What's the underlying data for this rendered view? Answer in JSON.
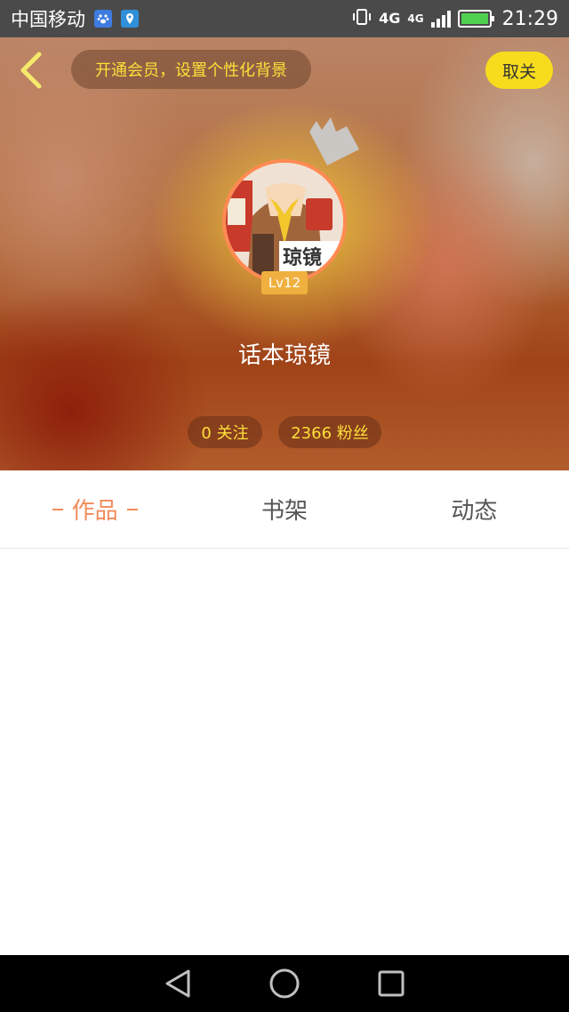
{
  "status_bar": {
    "carrier": "中国移动",
    "network_1": "4G",
    "network_2": "4G",
    "time": "21:29",
    "icons": [
      "baidu-paw-icon",
      "map-pin-icon",
      "vibrate-icon",
      "signal-icon",
      "battery-icon"
    ],
    "battery_color": "#4fd14f"
  },
  "header": {
    "vip_prompt": "开通会员，设置个性化背景",
    "unfollow_label": "取关",
    "level": "Lv12",
    "username": "话本琼镜",
    "follow_count_label": "0 关注",
    "fans_count_label": "2366 粉丝",
    "avatar_text": "琼镜"
  },
  "tabs": [
    {
      "label": "作品",
      "active": true
    },
    {
      "label": "书架",
      "active": false
    },
    {
      "label": "动态",
      "active": false
    }
  ],
  "colors": {
    "accent": "#f28b5a",
    "highlight_yellow": "#ffdf3a",
    "button_yellow": "#f7dc1e"
  }
}
